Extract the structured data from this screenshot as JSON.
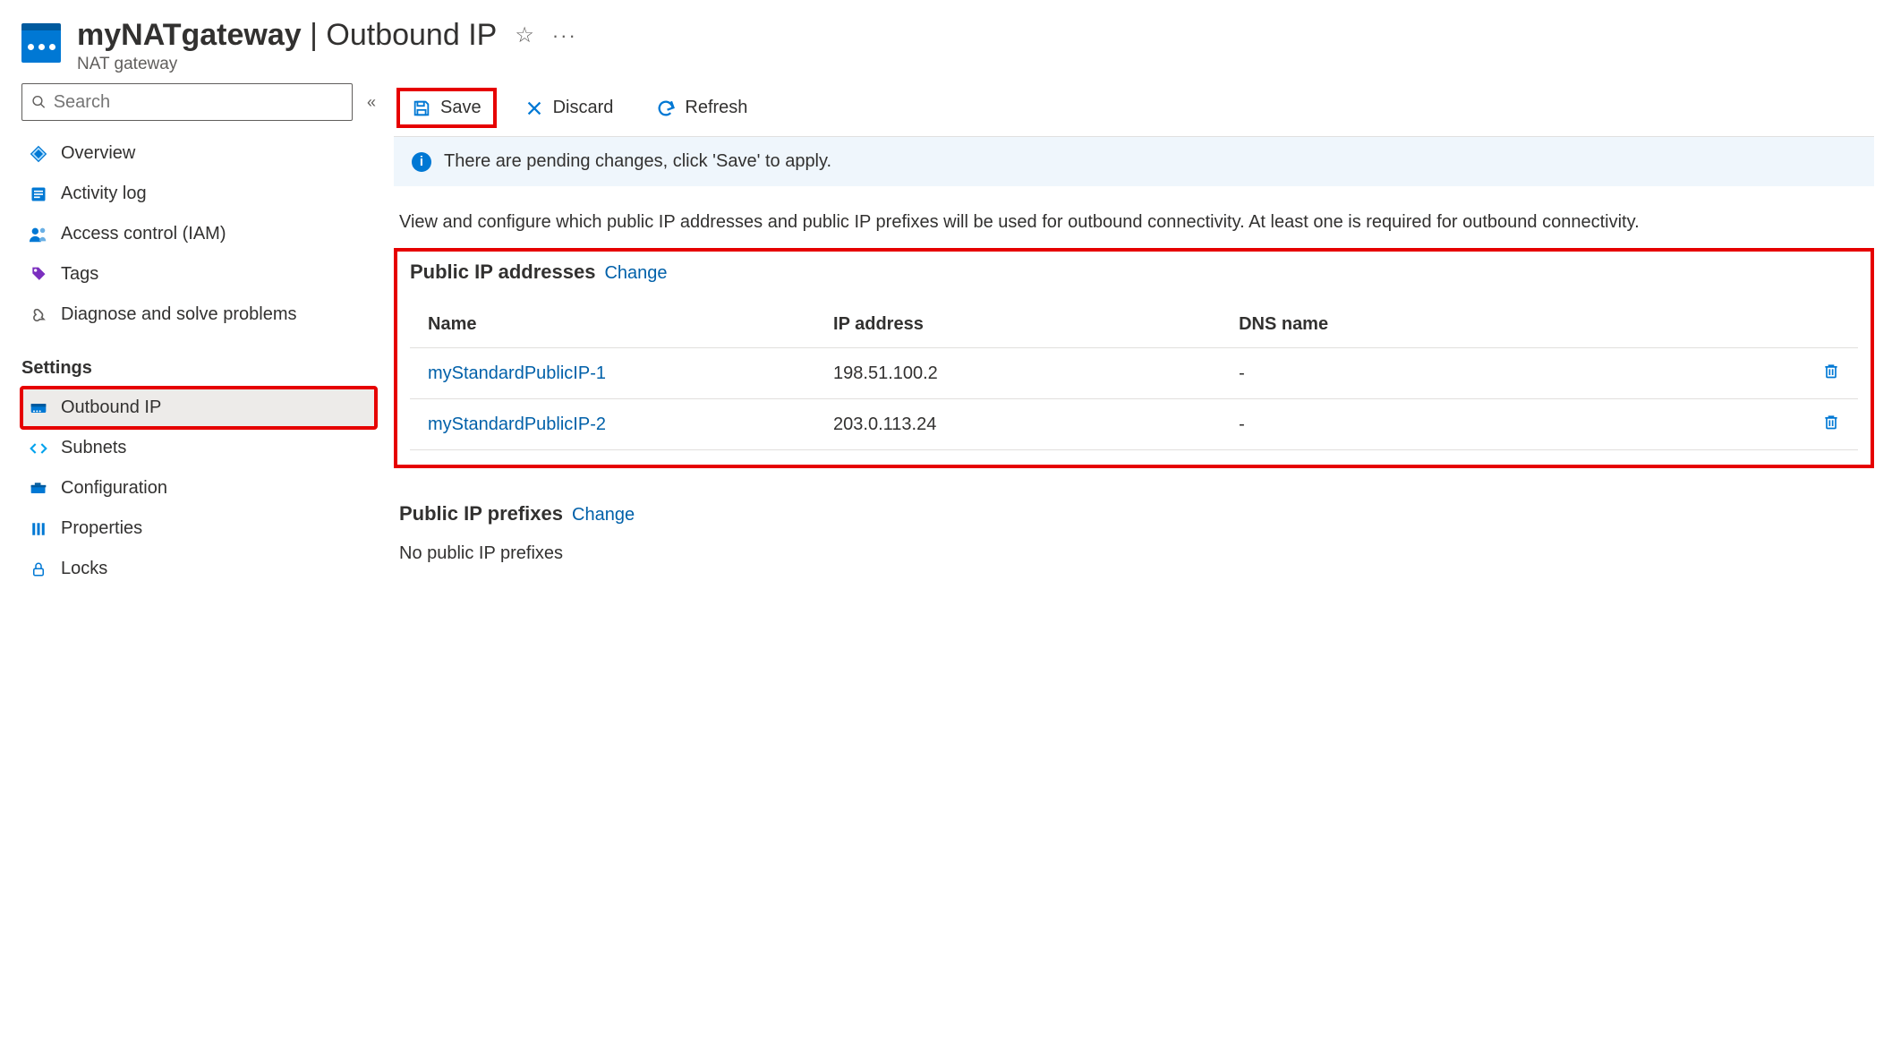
{
  "header": {
    "title_bold": "myNATgateway",
    "title_sep": " | ",
    "title_rest": "Outbound IP",
    "subtitle": "NAT gateway"
  },
  "search": {
    "placeholder": "Search"
  },
  "nav": {
    "overview": "Overview",
    "activity_log": "Activity log",
    "iam": "Access control (IAM)",
    "tags": "Tags",
    "diagnose": "Diagnose and solve problems",
    "section_settings": "Settings",
    "outbound_ip": "Outbound IP",
    "subnets": "Subnets",
    "configuration": "Configuration",
    "properties": "Properties",
    "locks": "Locks"
  },
  "toolbar": {
    "save": "Save",
    "discard": "Discard",
    "refresh": "Refresh"
  },
  "info_bar": "There are pending changes, click 'Save' to apply.",
  "description": "View and configure which public IP addresses and public IP prefixes will be used for outbound connectivity. At least one is required for outbound connectivity.",
  "ip_section": {
    "title": "Public IP addresses",
    "change": "Change",
    "columns": {
      "name": "Name",
      "ip": "IP address",
      "dns": "DNS name"
    },
    "rows": [
      {
        "name": "myStandardPublicIP-1",
        "ip": "198.51.100.2",
        "dns": "-"
      },
      {
        "name": "myStandardPublicIP-2",
        "ip": "203.0.113.24",
        "dns": "-"
      }
    ]
  },
  "prefix_section": {
    "title": "Public IP prefixes",
    "change": "Change",
    "empty": "No public IP prefixes"
  }
}
